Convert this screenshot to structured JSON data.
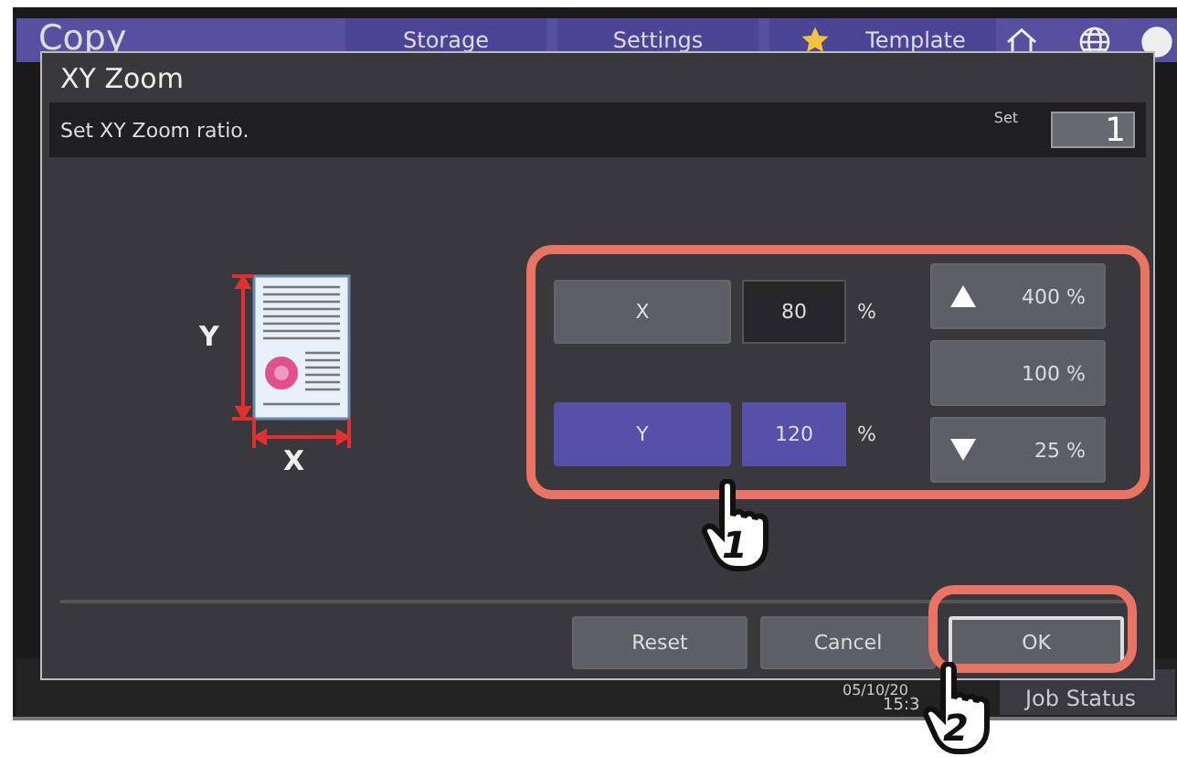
{
  "header": {
    "title": "Copy",
    "tabs": [
      {
        "label": "Storage",
        "kind": "plain"
      },
      {
        "label": "Settings",
        "kind": "plain"
      },
      {
        "label": "Template",
        "kind": "star"
      }
    ]
  },
  "dialog": {
    "title": "XY Zoom",
    "instruction": "Set XY Zoom ratio.",
    "set_label": "Set",
    "set_value": "1",
    "diagram": {
      "y_label": "Y",
      "x_label": "X"
    },
    "axes": [
      {
        "label": "X",
        "value": "80",
        "unit": "%",
        "selected": false
      },
      {
        "label": "Y",
        "value": "120",
        "unit": "%",
        "selected": true
      }
    ],
    "presets": [
      {
        "kind": "up",
        "label": "400 %"
      },
      {
        "kind": "plain",
        "label": "100 %"
      },
      {
        "kind": "down",
        "label": "25 %"
      }
    ],
    "buttons": [
      {
        "label": "Reset",
        "highlighted": false
      },
      {
        "label": "Cancel",
        "highlighted": false
      },
      {
        "label": "OK",
        "highlighted": true
      }
    ]
  },
  "status_bar": {
    "date": "05/10/20",
    "time": "15:3",
    "job_status": "Job Status"
  },
  "callouts": [
    {
      "number": "1"
    },
    {
      "number": "2"
    }
  ]
}
